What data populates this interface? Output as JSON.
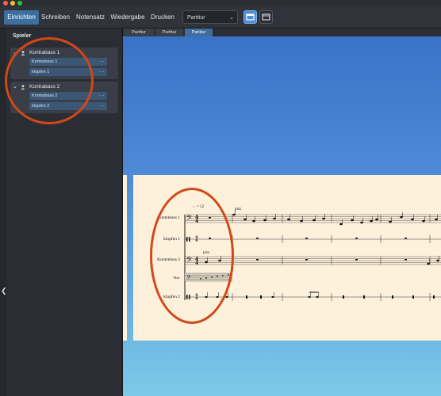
{
  "window": {
    "traffic_lights": [
      "#ff5f57",
      "#febc2e",
      "#28c840"
    ]
  },
  "toolbar": {
    "tabs": [
      {
        "label": "Einrichten",
        "active": true
      },
      {
        "label": "Schreiben",
        "active": false
      },
      {
        "label": "Notensatz",
        "active": false
      },
      {
        "label": "Wiedergabe",
        "active": false
      },
      {
        "label": "Drucken",
        "active": false
      }
    ],
    "layout_select": "Partitur",
    "view_buttons": [
      "galley-view-icon",
      "page-view-icon"
    ]
  },
  "panel": {
    "title": "Spieler",
    "players": [
      {
        "name": "Kontrabass 1",
        "instruments": [
          {
            "label": "Kontrabass 1",
            "more": "···"
          },
          {
            "label": "klopfen 1",
            "more": "···"
          }
        ]
      },
      {
        "name": "Kontrabass 2",
        "instruments": [
          {
            "label": "Kontrabass 2",
            "more": "···"
          },
          {
            "label": "klopfen 2",
            "more": "···"
          }
        ]
      }
    ],
    "collapse_glyph": "❮"
  },
  "view_tabs": [
    {
      "label": "Partitur",
      "active": false
    },
    {
      "label": "Partitur",
      "active": false
    },
    {
      "label": "Partitur",
      "active": true
    }
  ],
  "score": {
    "tempo": "♩= 52",
    "staves": [
      "Kontrabass 1",
      "klopfen 1",
      "Kontrabass 2",
      "Mod.",
      "klopfen 2"
    ],
    "expressions": [
      "pizz.",
      "pizz."
    ]
  },
  "colors": {
    "accent": "#3d6f9e",
    "annotation": "#d24818",
    "paper": "#fdf1db"
  }
}
